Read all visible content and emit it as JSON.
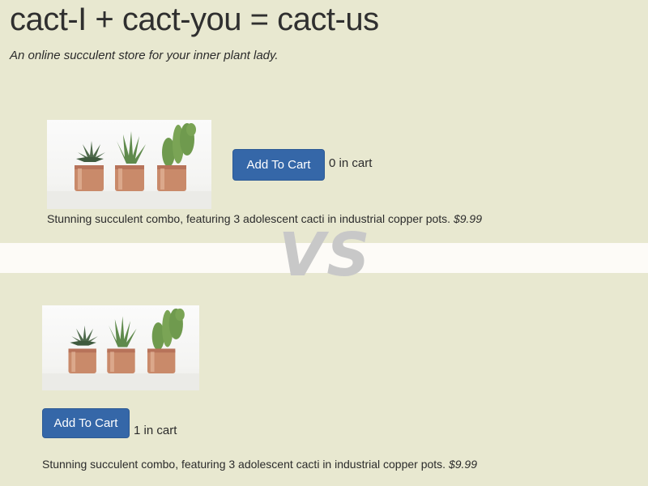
{
  "header": {
    "title": "cact-I + cact-you = cact-us",
    "tagline": "An online succulent store for your inner plant lady."
  },
  "divider": {
    "text": "VS"
  },
  "variants": [
    {
      "button_label": "Add To Cart",
      "cart_count_text": "0 in cart",
      "description": "Stunning succulent combo, featuring 3 adolescent cacti in industrial copper pots.",
      "price": "$9.99"
    },
    {
      "button_label": "Add To Cart",
      "cart_count_text": "1 in cart",
      "description": "Stunning succulent combo, featuring 3 adolescent cacti in industrial copper pots.",
      "price": "$9.99"
    }
  ],
  "colors": {
    "background": "#e8e8d0",
    "button": "#3567a8",
    "vs_band": "#fdfbf7",
    "vs_text": "#c8c8c8",
    "copper_pot": "#c98a6a"
  }
}
